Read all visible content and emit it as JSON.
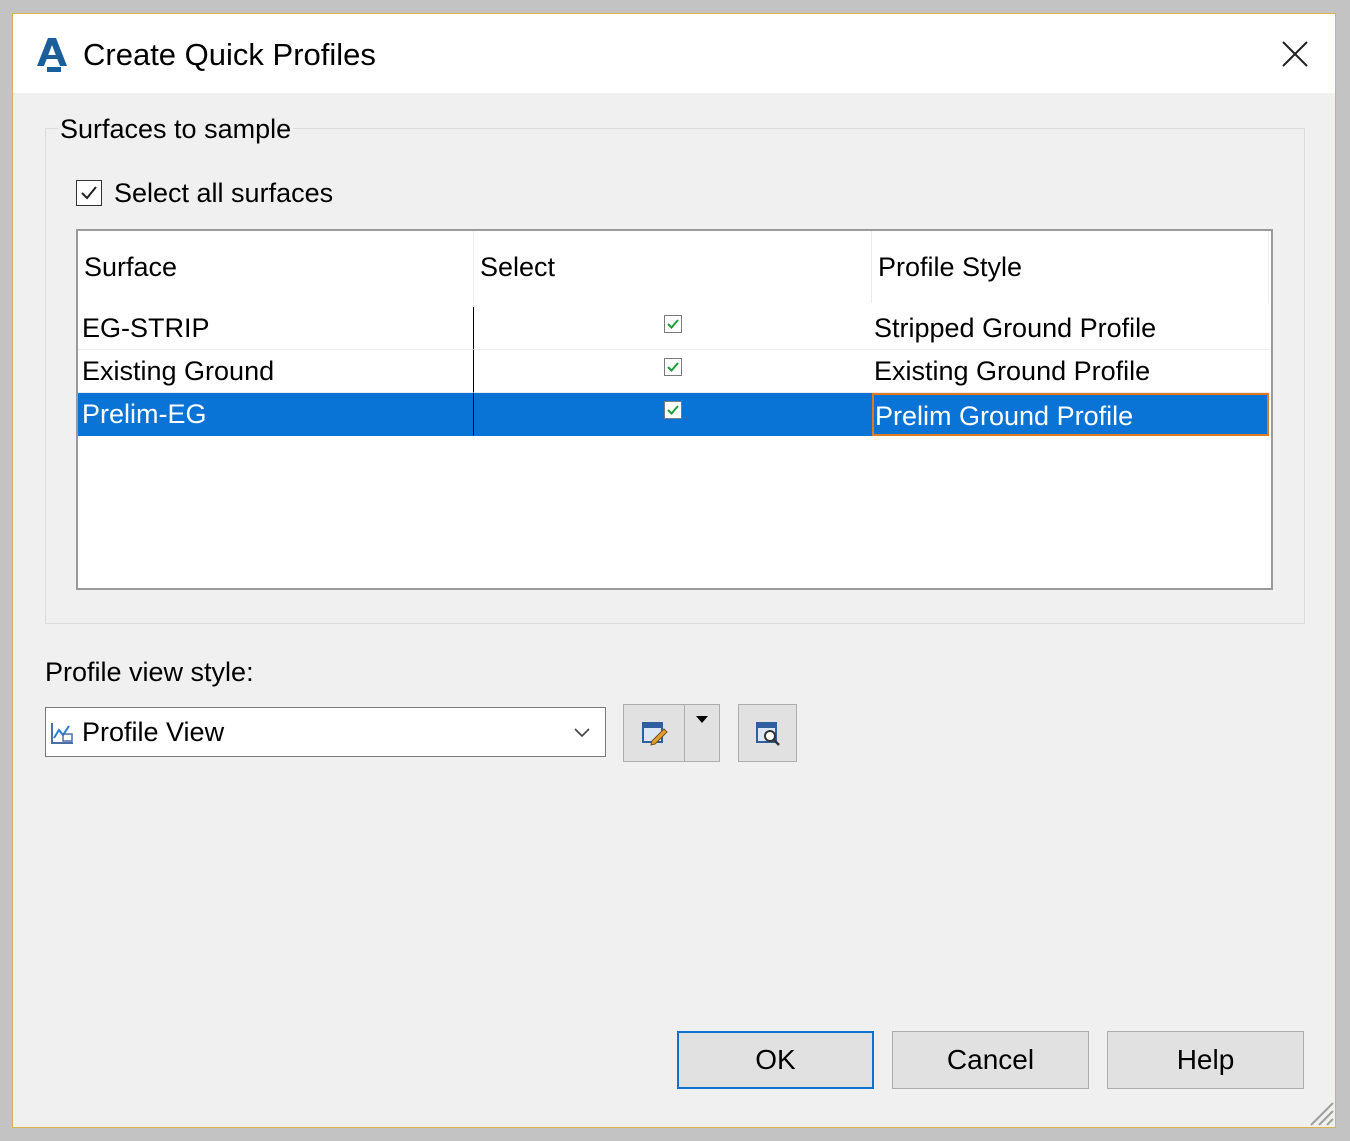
{
  "window": {
    "title": "Create Quick Profiles",
    "app_icon": "autocad-civil3d-icon",
    "close_icon": "close-icon"
  },
  "surfaces_group": {
    "legend": "Surfaces to sample",
    "select_all_label": "Select all surfaces",
    "select_all_checked": true,
    "columns": [
      "Surface",
      "Select",
      "Profile Style"
    ],
    "rows": [
      {
        "surface": "EG-STRIP",
        "checked": true,
        "style": "Stripped Ground Profile"
      },
      {
        "surface": "Existing Ground",
        "checked": true,
        "style": "Existing Ground Profile"
      },
      {
        "surface": "Prelim-EG",
        "checked": true,
        "style": "Prelim Ground Profile",
        "selected": true
      }
    ]
  },
  "profile_view": {
    "label": "Profile view style:",
    "value": "Profile View",
    "icon": "profile-view-style-icon"
  },
  "buttons": {
    "ok": "OK",
    "cancel": "Cancel",
    "help": "Help"
  },
  "colors": {
    "selection": "#0a74d6",
    "focus_outline": "#e07a1f",
    "check_green": "#1e9e3a"
  }
}
